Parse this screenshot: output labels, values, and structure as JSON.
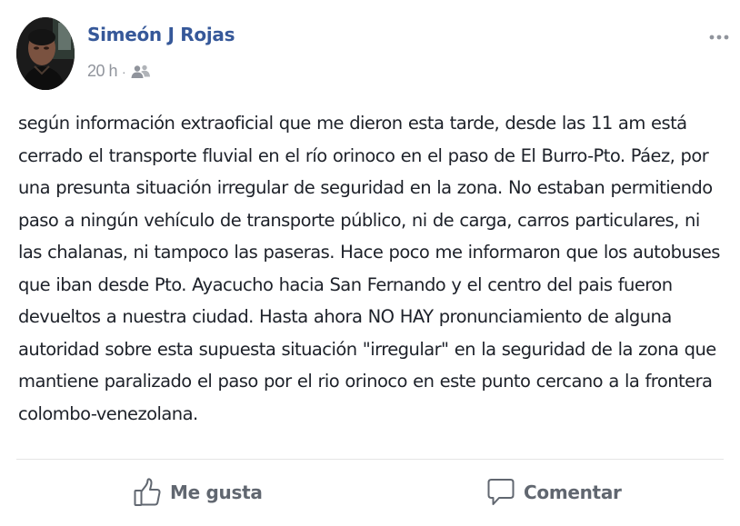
{
  "post": {
    "author": "Simeón J Rojas",
    "timestamp": "20 h",
    "separator": "·",
    "audience_icon": "friends-icon",
    "more_icon": "more-options-icon",
    "text": "según información extraoficial que me dieron esta tarde, desde las 11 am está cerrado el transporte fluvial en el río orinoco en el paso de El Burro-Pto. Páez, por una presunta situación irregular de seguridad en la zona. No estaban permitiendo paso a ningún vehículo de transporte público, ni de carga, carros particulares, ni las chalanas, ni tampoco las paseras. Hace poco me informaron que los autobuses que iban desde Pto. Ayacucho hacia San Fernando y el centro del pais fueron devueltos a nuestra ciudad. Hasta ahora NO HAY pronunciamiento de alguna autoridad sobre esta supuesta situación \"irregular\" en la seguridad de la zona que mantiene paralizado el paso por el rio orinoco en este punto cercano a la frontera colombo-venezolana."
  },
  "actions": {
    "like_label": "Me gusta",
    "like_icon": "thumbs-up-icon",
    "comment_label": "Comentar",
    "comment_icon": "speech-bubble-icon"
  },
  "colors": {
    "author_link": "#365899",
    "meta_gray": "#90949c",
    "action_gray": "#616770",
    "body_text": "#1d2129"
  }
}
